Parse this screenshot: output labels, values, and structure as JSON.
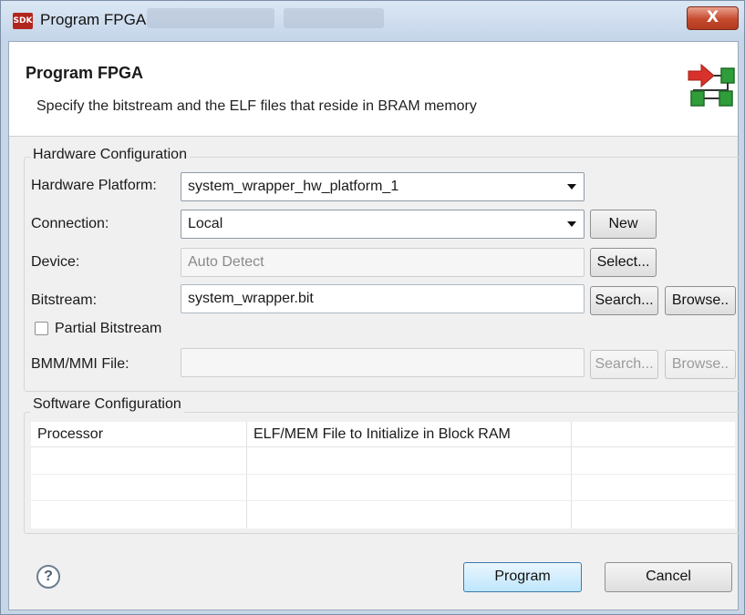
{
  "window": {
    "app_icon_text": "SDK",
    "title": "Program FPGA",
    "close_glyph": "X"
  },
  "header": {
    "title": "Program FPGA",
    "description": "Specify the bitstream and the ELF files that reside in BRAM memory",
    "logo_icon": "program-fpga-logo-icon"
  },
  "hardware": {
    "legend": "Hardware Configuration",
    "platform_label": "Hardware Platform:",
    "platform_value": "system_wrapper_hw_platform_1",
    "connection_label": "Connection:",
    "connection_value": "Local",
    "new_button": "New",
    "device_label": "Device:",
    "device_value": "Auto Detect",
    "select_button": "Select...",
    "bitstream_label": "Bitstream:",
    "bitstream_value": "system_wrapper.bit",
    "bitstream_search_button": "Search...",
    "bitstream_browse_button": "Browse..",
    "partial_bitstream_label": "Partial Bitstream",
    "partial_bitstream_checked": false,
    "bmm_label": "BMM/MMI File:",
    "bmm_value": "",
    "bmm_search_button": "Search...",
    "bmm_browse_button": "Browse.."
  },
  "software": {
    "legend": "Software Configuration",
    "columns": [
      "Processor",
      "ELF/MEM File to Initialize in Block RAM",
      ""
    ]
  },
  "footer": {
    "help_glyph": "?",
    "program_button": "Program",
    "cancel_button": "Cancel"
  },
  "colors": {
    "accent_red": "#d7322b",
    "accent_green": "#2f9d3a",
    "close_red": "#c54a2e"
  }
}
